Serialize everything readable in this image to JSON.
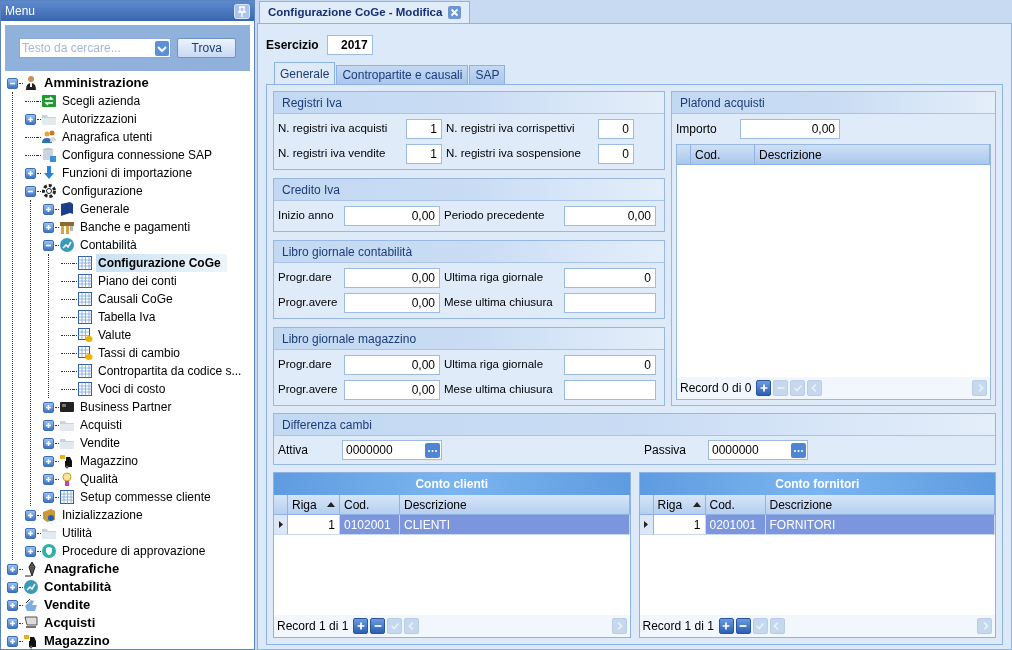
{
  "menu": {
    "title": "Menu",
    "search": {
      "placeholder": "Testo da cercare..."
    },
    "find_button": "Trova",
    "tree": [
      {
        "label": "Amministrazione",
        "kind": "person",
        "expanded": true,
        "selected": false,
        "children": [
          {
            "label": "Scegli azienda",
            "kind": "exchange",
            "selected": false
          },
          {
            "label": "Autorizzazioni",
            "kind": "folder",
            "expanded": false,
            "selected": false
          },
          {
            "label": "Anagrafica utenti",
            "kind": "people",
            "selected": false
          },
          {
            "label": "Configura connessione SAP",
            "kind": "database",
            "selected": false
          },
          {
            "label": "Funzioni di importazione",
            "kind": "download",
            "expanded": false,
            "selected": false
          },
          {
            "label": "Configurazione",
            "kind": "gear",
            "expanded": true,
            "selected": false,
            "children": [
              {
                "label": "Generale",
                "kind": "book",
                "expanded": false,
                "selected": false
              },
              {
                "label": "Banche e pagamenti",
                "kind": "bank",
                "expanded": false,
                "selected": false
              },
              {
                "label": "Contabilità",
                "kind": "chart",
                "expanded": true,
                "selected": false,
                "children": [
                  {
                    "label": "Configurazione CoGe",
                    "kind": "table",
                    "selected": true
                  },
                  {
                    "label": "Piano dei conti",
                    "kind": "table",
                    "selected": false
                  },
                  {
                    "label": "Causali CoGe",
                    "kind": "table",
                    "selected": false
                  },
                  {
                    "label": "Tabella Iva",
                    "kind": "table",
                    "selected": false
                  },
                  {
                    "label": "Valute",
                    "kind": "coins",
                    "selected": false
                  },
                  {
                    "label": "Tassi di cambio",
                    "kind": "coins",
                    "selected": false
                  },
                  {
                    "label": "Contropartita da codice s...",
                    "kind": "table",
                    "selected": false
                  },
                  {
                    "label": "Voci di costo",
                    "kind": "table",
                    "selected": false
                  }
                ]
              },
              {
                "label": "Business Partner",
                "kind": "card",
                "expanded": false,
                "selected": false
              },
              {
                "label": "Acquisti",
                "kind": "folder",
                "expanded": false,
                "selected": false
              },
              {
                "label": "Vendite",
                "kind": "folder",
                "expanded": false,
                "selected": false
              },
              {
                "label": "Magazzino",
                "kind": "forklift",
                "expanded": false,
                "selected": false
              },
              {
                "label": "Qualità",
                "kind": "bulb",
                "expanded": false,
                "selected": false
              },
              {
                "label": "Setup commesse cliente",
                "kind": "table",
                "expanded": false,
                "selected": false
              }
            ]
          },
          {
            "label": "Inizializzazione",
            "kind": "setup",
            "expanded": false,
            "selected": false
          },
          {
            "label": "Utilità",
            "kind": "folder",
            "expanded": false,
            "selected": false
          },
          {
            "label": "Procedure di approvazione",
            "kind": "shield",
            "expanded": false,
            "selected": false
          }
        ]
      },
      {
        "label": "Anagrafiche",
        "kind": "pen",
        "expanded": false,
        "selected": false
      },
      {
        "label": "Contabilità",
        "kind": "chart",
        "expanded": false,
        "selected": false
      },
      {
        "label": "Vendite",
        "kind": "sales",
        "expanded": false,
        "selected": false
      },
      {
        "label": "Acquisti",
        "kind": "cart",
        "expanded": false,
        "selected": false
      },
      {
        "label": "Magazzino",
        "kind": "forklift",
        "expanded": false,
        "selected": false
      }
    ]
  },
  "document_tab": {
    "title": "Configurazione CoGe - Modifica"
  },
  "esercizio": {
    "label": "Esercizio",
    "value": "2017"
  },
  "tabs": [
    {
      "label": "Generale",
      "selected": true
    },
    {
      "label": "Contropartite e causali",
      "selected": false
    },
    {
      "label": "SAP",
      "selected": false
    }
  ],
  "groups": [
    {
      "title": "Registri Iva",
      "kind": "counts",
      "rows": [
        [
          {
            "label": "N. registri iva acquisti",
            "value": "1"
          },
          {
            "label": "N. registri iva corrispettivi",
            "value": "0"
          }
        ],
        [
          {
            "label": "N. registri iva vendite",
            "value": "1"
          },
          {
            "label": "N. registri iva sospensione",
            "value": "0"
          }
        ]
      ]
    },
    {
      "title": "Credito Iva",
      "kind": "amounts",
      "rows": [
        [
          {
            "label": "Inizio anno",
            "value": "0,00"
          },
          {
            "label": "Periodo precedente",
            "value": "0,00"
          }
        ]
      ]
    },
    {
      "title": "Libro giornale contabilità",
      "kind": "amounts",
      "rows": [
        [
          {
            "label": "Progr.dare",
            "value": "0,00"
          },
          {
            "label": "Ultima riga giornale",
            "value": "0"
          }
        ],
        [
          {
            "label": "Progr.avere",
            "value": "0,00"
          },
          {
            "label": "Mese ultima chiusura"
          }
        ]
      ]
    },
    {
      "title": "Libro giornale magazzino",
      "kind": "amounts",
      "rows": [
        [
          {
            "label": "Progr.dare",
            "value": "0,00"
          },
          {
            "label": "Ultima riga giornale",
            "value": "0"
          }
        ],
        [
          {
            "label": "Progr.avere",
            "value": "0,00"
          },
          {
            "label": "Mese ultima chiusura"
          }
        ]
      ]
    }
  ],
  "plafond": {
    "title": "Plafond acquisti",
    "label": "Importo",
    "value": "0,00",
    "grid": {
      "columns": [
        {
          "label": "Cod."
        },
        {
          "label": "Descrizione"
        }
      ],
      "record": "Record 0 di 0",
      "navigator": [
        {
          "kind": "add",
          "disabled": false
        },
        {
          "kind": "remove",
          "disabled": true
        },
        {
          "kind": "confirm",
          "disabled": true
        },
        {
          "kind": "prev",
          "disabled": true
        },
        {
          "kind": "next",
          "disabled": true
        }
      ]
    }
  },
  "differenza_cambi": {
    "title": "Differenza cambi",
    "fields": [
      {
        "label": "Attiva",
        "value": "0000000"
      },
      {
        "label": "Passiva",
        "value": "0000000"
      }
    ]
  },
  "grids": [
    {
      "title": "Conto clienti",
      "columns": [
        {
          "label": "Riga",
          "sorted_ascending": true
        },
        {
          "label": "Cod."
        },
        {
          "label": "Descrizione"
        }
      ],
      "rows": [
        {
          "cells": [
            "1",
            "0102001",
            "CLIENTI"
          ],
          "selected": true
        }
      ],
      "record": "Record 1 di 1",
      "navigator": [
        {
          "kind": "add",
          "disabled": false
        },
        {
          "kind": "remove",
          "disabled": false
        },
        {
          "kind": "confirm",
          "disabled": true
        },
        {
          "kind": "prev",
          "disabled": true
        },
        {
          "kind": "next",
          "disabled": true
        }
      ]
    },
    {
      "title": "Conto fornitori",
      "columns": [
        {
          "label": "Riga",
          "sorted_ascending": true
        },
        {
          "label": "Cod."
        },
        {
          "label": "Descrizione"
        }
      ],
      "rows": [
        {
          "cells": [
            "1",
            "0201001",
            "FORNITORI"
          ],
          "selected": true
        }
      ],
      "record": "Record 1 di 1",
      "navigator": [
        {
          "kind": "add",
          "disabled": false
        },
        {
          "kind": "remove",
          "disabled": false
        },
        {
          "kind": "confirm",
          "disabled": true
        },
        {
          "kind": "prev",
          "disabled": true
        },
        {
          "kind": "next",
          "disabled": true
        }
      ]
    }
  ]
}
